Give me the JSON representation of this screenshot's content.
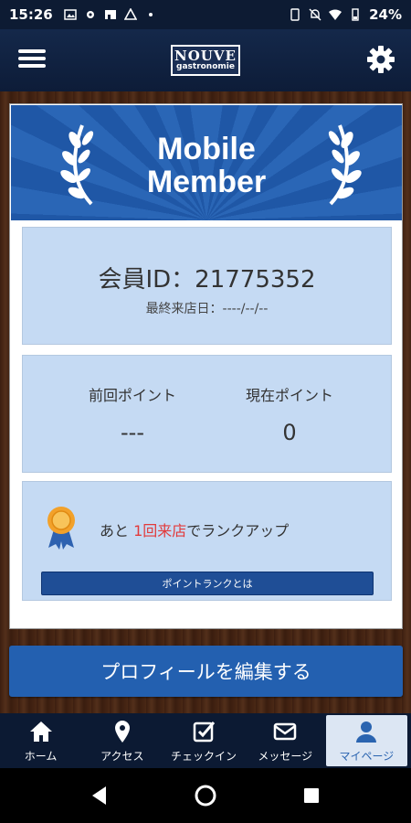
{
  "status_bar": {
    "time": "15:26",
    "battery": "24%",
    "icons": [
      "image-icon",
      "gear-flower-icon",
      "store-icon",
      "drive-icon",
      "dot-icon",
      "rotate-icon",
      "bell-off-icon",
      "wifi-icon",
      "battery-icon"
    ]
  },
  "header": {
    "logo_top": "NOUVE",
    "logo_bottom": "gastronomie",
    "menu_icon": "hamburger-menu-icon",
    "settings_icon": "gear-icon"
  },
  "banner": {
    "line1": "Mobile",
    "line2": "Member"
  },
  "member": {
    "id_text": "会員ID：21775352",
    "last_visit": "最終来店日：----/--/--"
  },
  "points": {
    "prev_label": "前回ポイント",
    "prev_value": "---",
    "curr_label": "現在ポイント",
    "curr_value": "0"
  },
  "rank": {
    "text_before": "あと ",
    "highlight": "1回来店",
    "text_after": "でランクアップ",
    "button_label": "ポイントランクとは",
    "highlight_color": "#e23a3a"
  },
  "profile_button": "プロフィールを編集する",
  "nav": {
    "items": [
      {
        "label": "ホーム",
        "icon": "home-icon"
      },
      {
        "label": "アクセス",
        "icon": "map-pin-icon"
      },
      {
        "label": "チェックイン",
        "icon": "checkbox-icon"
      },
      {
        "label": "メッセージ",
        "icon": "envelope-icon"
      },
      {
        "label": "マイページ",
        "icon": "user-icon"
      }
    ],
    "active_index": 4
  },
  "colors": {
    "header_bg": "#0d1c38",
    "accent": "#2360b0",
    "panel_bg": "#c5daf3"
  }
}
